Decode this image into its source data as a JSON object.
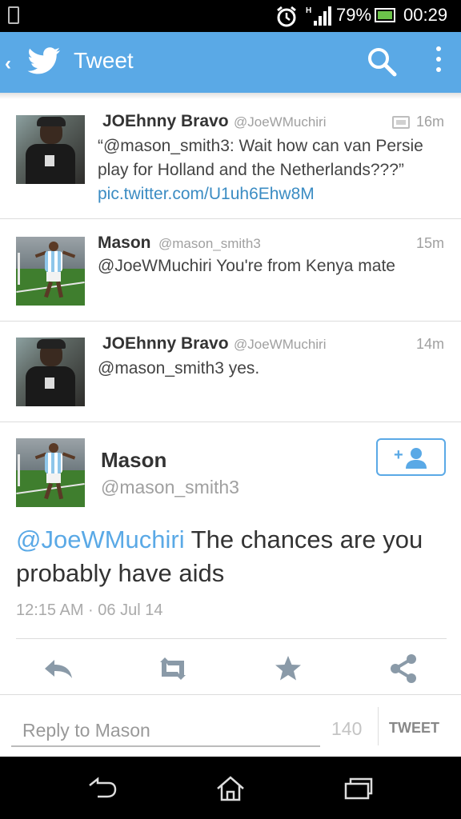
{
  "status_bar": {
    "battery": "79%",
    "time": "00:29"
  },
  "action_bar": {
    "title": "Tweet"
  },
  "thread": [
    {
      "name": "JOEhnny Bravo",
      "handle": "@JoeWMuchiri",
      "time": "16m",
      "text_quote": "“@mason_smith3: Wait how can van Persie play for Holland and the Netherlands???”",
      "link": "pic.twitter.com/U1uh6Ehw8M"
    },
    {
      "name": "Mason",
      "handle": "@mason_smith3",
      "time": "15m",
      "text": "@JoeWMuchiri You're from Kenya mate"
    },
    {
      "name": "JOEhnny Bravo",
      "handle": "@JoeWMuchiri",
      "time": "14m",
      "text": "@mason_smith3 yes."
    }
  ],
  "focused_tweet": {
    "name": "Mason",
    "handle": "@mason_smith3",
    "mention": "@JoeWMuchiri",
    "text": " The chances are you probably have aids",
    "timestamp": "12:15 AM · 06 Jul 14"
  },
  "reply": {
    "placeholder": "Reply to Mason",
    "char_count": "140",
    "button_label": "TWEET"
  },
  "colors": {
    "accent": "#5aa9e6",
    "link": "#3b8cc3",
    "icon_gray": "#8a9aa8"
  }
}
